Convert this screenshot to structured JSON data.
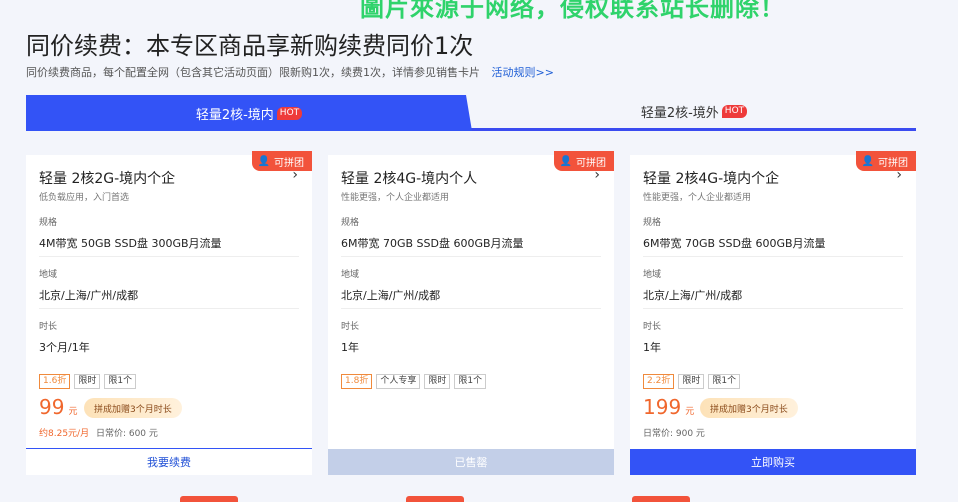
{
  "watermark": "圖片來源于网络，侵权联系站长删除！",
  "title": "同价续费：本专区商品享新购续费同价1次",
  "subtitle": "同价续费商品，每个配置全网（包含其它活动页面）限新购1次，续费1次，详情参见销售卡片",
  "rules_link": "活动规则>>",
  "tabs": [
    {
      "label": "轻量2核-境内",
      "badge": "HOT"
    },
    {
      "label": "轻量2核-境外",
      "badge": "HOT"
    }
  ],
  "cards": [
    {
      "badge": "可拼团",
      "name": "轻量 2核2G-境内个企",
      "desc": "低负载应用，入门首选",
      "spec_label": "规格",
      "spec": "4M带宽 50GB SSD盘 300GB月流量",
      "region_label": "地域",
      "region": "北京/上海/广州/成都",
      "duration_label": "时长",
      "duration": "3个月/1年",
      "tags": [
        "1.6折",
        "限时",
        "限1个"
      ],
      "price": "99",
      "unit": "元",
      "promo": "拼成加赠3个月时长",
      "monthly": "约8.25元/月",
      "daily": "日常价: 600 元",
      "action": "我要续费"
    },
    {
      "badge": "可拼团",
      "name": "轻量 2核4G-境内个人",
      "desc": "性能更强，个人企业都适用",
      "spec_label": "规格",
      "spec": "6M带宽 70GB SSD盘 600GB月流量",
      "region_label": "地域",
      "region": "北京/上海/广州/成都",
      "duration_label": "时长",
      "duration": "1年",
      "tags": [
        "1.8折",
        "个人专享",
        "限时",
        "限1个"
      ],
      "action": "已售罄"
    },
    {
      "badge": "可拼团",
      "name": "轻量 2核4G-境内个企",
      "desc": "性能更强，个人企业都适用",
      "spec_label": "规格",
      "spec": "6M带宽 70GB SSD盘 600GB月流量",
      "region_label": "地域",
      "region": "北京/上海/广州/成都",
      "duration_label": "时长",
      "duration": "1年",
      "tags": [
        "2.2折",
        "限时",
        "限1个"
      ],
      "price": "199",
      "unit": "元",
      "promo": "拼成加赠3个月时长",
      "daily": "日常价: 900 元",
      "action": "立即购买"
    }
  ]
}
